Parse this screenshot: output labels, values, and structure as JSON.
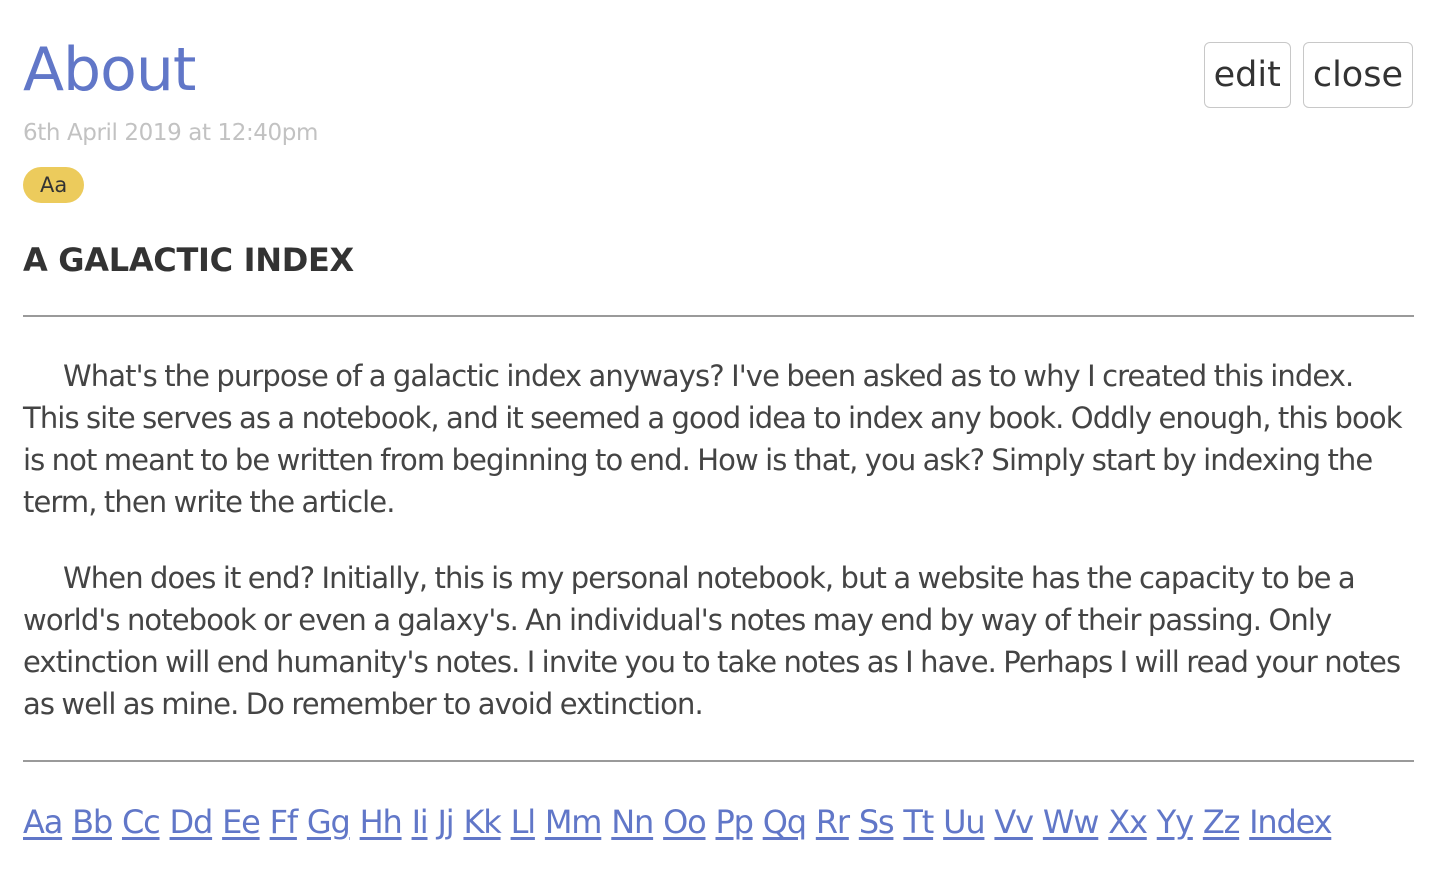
{
  "header": {
    "title": "About",
    "edit_label": "edit",
    "close_label": "close"
  },
  "meta": {
    "date": "6th April 2019 at 12:40pm",
    "tag": "Aa",
    "tag_color": "#eccb5c"
  },
  "article": {
    "heading": "A GALACTIC INDEX",
    "paragraphs": [
      "What's the purpose of a galactic index anyways? I've been asked as to why I created this index. This site serves as a notebook, and it seemed a good idea to index any book. Oddly enough, this book is not meant to be written from beginning to end. How is that, you ask? Simply start by indexing the term, then write the article.",
      "When does it end? Initially, this is my personal notebook, but a website has the capacity to be a world's notebook or even a galaxy's. An individual's notes may end by way of their passing. Only extinction will end humanity's notes. I invite you to take notes as I have. Perhaps I will read your notes as well as mine. Do remember to avoid extinction."
    ]
  },
  "index_links": [
    "Aa",
    "Bb",
    "Cc",
    "Dd",
    "Ee",
    "Ff",
    "Gg",
    "Hh",
    "Ii",
    "Jj",
    "Kk",
    "Ll",
    "Mm",
    "Nn",
    "Oo",
    "Pp",
    "Qq",
    "Rr",
    "Ss",
    "Tt",
    "Uu",
    "Vv",
    "Ww",
    "Xx",
    "Yy",
    "Zz",
    "Index"
  ],
  "colors": {
    "accent": "#6177c8",
    "text": "#333333",
    "muted": "#c2c2c2"
  }
}
